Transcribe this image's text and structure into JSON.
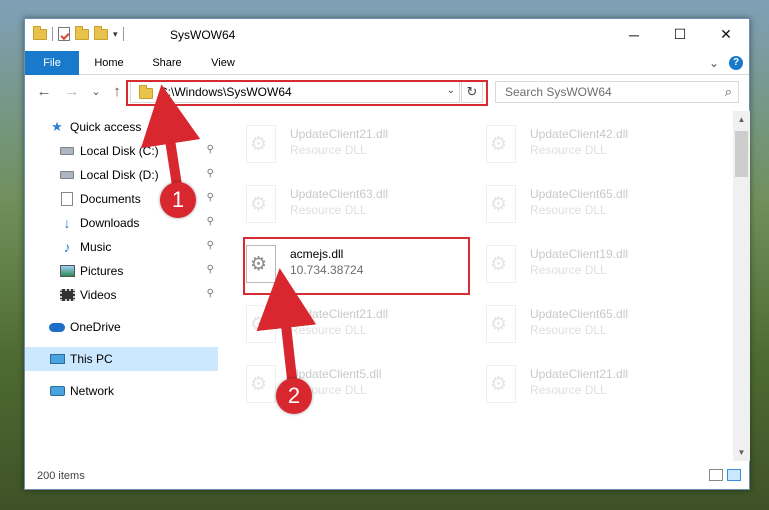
{
  "window": {
    "title": "SysWOW64",
    "minimize_glyph": "─",
    "maximize_glyph": "☐",
    "close_glyph": "✕"
  },
  "ribbon": {
    "tabs": [
      "File",
      "Home",
      "Share",
      "View"
    ],
    "expand_glyph": "⌄",
    "help_glyph": "?"
  },
  "nav": {
    "back_glyph": "←",
    "forward_glyph": "→",
    "recent_glyph": "⌄",
    "up_glyph": "↑",
    "address_path": "C:\\Windows\\SysWOW64",
    "address_dropdown_glyph": "⌄",
    "refresh_glyph": "↻",
    "search_placeholder": "Search SysWOW64",
    "search_glyph": "⌕"
  },
  "sidebar": {
    "items": [
      {
        "label": "Quick access",
        "icon": "star-icon"
      },
      {
        "label": "Local Disk (C:)",
        "icon": "disk-icon"
      },
      {
        "label": "Local Disk (D:)",
        "icon": "disk-icon"
      },
      {
        "label": "Documents",
        "icon": "documents-icon"
      },
      {
        "label": "Downloads",
        "icon": "downloads-icon"
      },
      {
        "label": "Music",
        "icon": "music-icon"
      },
      {
        "label": "Pictures",
        "icon": "pictures-icon"
      },
      {
        "label": "Videos",
        "icon": "videos-icon"
      },
      {
        "label": "OneDrive",
        "icon": "onedrive-icon"
      },
      {
        "label": "This PC",
        "icon": "this-pc-icon",
        "selected": true
      },
      {
        "label": "Network",
        "icon": "network-icon"
      }
    ],
    "pin_glyph": "📌"
  },
  "files": [
    {
      "name": "UpdateClient21.dll",
      "desc": "Resource DLL",
      "faded": true
    },
    {
      "name": "UpdateClient42.dll",
      "desc": "Resource DLL",
      "faded": true
    },
    {
      "name": "UpdateClient63.dll",
      "desc": "Resource DLL",
      "faded": true
    },
    {
      "name": "UpdateClient65.dll",
      "desc": "Resource DLL",
      "faded": true
    },
    {
      "name": "acmejs.dll",
      "desc": "10.734.38724",
      "faded": false
    },
    {
      "name": "UpdateClient19.dll",
      "desc": "Resource DLL",
      "faded": true
    },
    {
      "name": "UpdateClient21.dll",
      "desc": "Resource DLL",
      "faded": true
    },
    {
      "name": "UpdateClient65.dll",
      "desc": "Resource DLL",
      "faded": true
    },
    {
      "name": "UpdateClient5.dll",
      "desc": "Resource DLL",
      "faded": true
    },
    {
      "name": "UpdateClient21.dll",
      "desc": "Resource DLL",
      "faded": true
    }
  ],
  "status": {
    "item_count": "200 items"
  },
  "annotations": {
    "step1": "1",
    "step2": "2",
    "highlight_color": "#d62b33"
  },
  "colors": {
    "accent": "#1979ca",
    "selection": "#cce8ff"
  }
}
